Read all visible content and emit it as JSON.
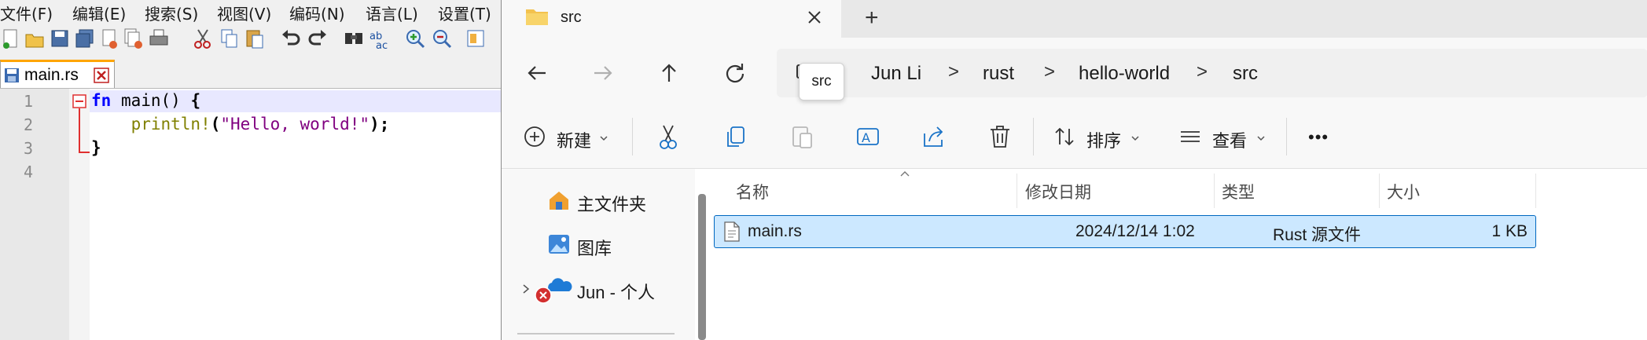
{
  "npp": {
    "menu": [
      "文件(F)",
      "编辑(E)",
      "搜索(S)",
      "视图(V)",
      "编码(N)",
      "语言(L)",
      "设置(T)"
    ],
    "tab_label": "main.rs",
    "line_numbers": [
      "1",
      "2",
      "3",
      "4"
    ],
    "code": {
      "l1_kw": "fn",
      "l1_rest": " main() ",
      "l1_brace": "{",
      "l2_indent": "    ",
      "l2_macro": "println!",
      "l2_paren": "(",
      "l2_str": "\"Hello, world!\"",
      "l2_end": ");",
      "l3_brace": "}"
    }
  },
  "explorer": {
    "tab_title": "src",
    "new_tab_glyph": "+",
    "breadcrumbs": [
      "Jun Li",
      "rust",
      "hello-world",
      "src"
    ],
    "breadcrumb_sep": ">",
    "tooltip": "src",
    "commands": {
      "new": "新建",
      "sort": "排序",
      "view": "查看",
      "more": "•••"
    },
    "nav_pane": {
      "home": "主文件夹",
      "gallery": "图库",
      "onedrive": "Jun - 个人"
    },
    "columns": {
      "name": "名称",
      "modified": "修改日期",
      "type": "类型",
      "size": "大小"
    },
    "files": [
      {
        "name": "main.rs",
        "modified": "2024/12/14 1:02",
        "type": "Rust 源文件",
        "size": "1 KB"
      }
    ]
  }
}
